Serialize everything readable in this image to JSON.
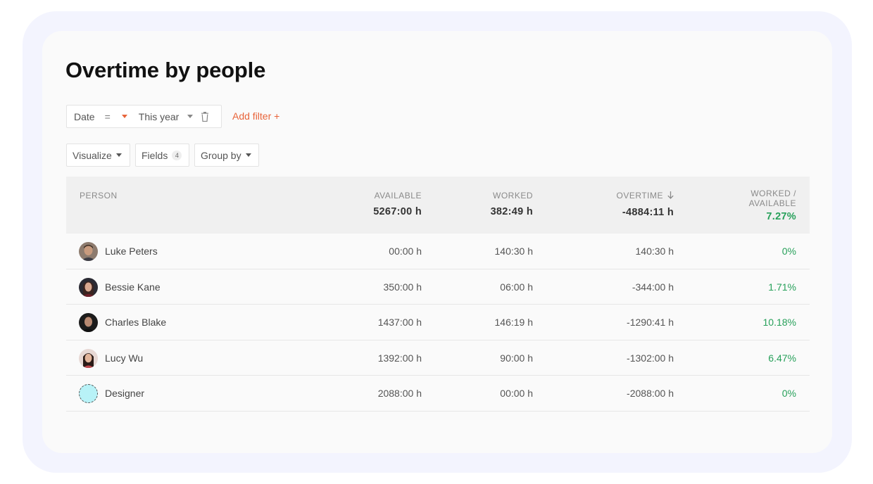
{
  "page": {
    "title": "Overtime by people"
  },
  "filter": {
    "field": "Date",
    "operator": "=",
    "value": "This year",
    "add_label": "Add filter +"
  },
  "toolbar": {
    "visualize_label": "Visualize",
    "fields_label": "Fields",
    "fields_count": "4",
    "group_by_label": "Group by"
  },
  "table": {
    "headers": {
      "person": "PERSON",
      "available": "AVAILABLE",
      "worked": "WORKED",
      "overtime": "OVERTIME",
      "ratio_line1": "WORKED /",
      "ratio_line2": "AVAILABLE"
    },
    "totals": {
      "available": "5267:00 h",
      "worked": "382:49 h",
      "overtime": "-4884:11 h",
      "ratio": "7.27%"
    },
    "rows": [
      {
        "name": "Luke Peters",
        "available": "00:00 h",
        "worked": "140:30 h",
        "overtime": "140:30 h",
        "ratio": "0%"
      },
      {
        "name": "Bessie Kane",
        "available": "350:00 h",
        "worked": "06:00 h",
        "overtime": "-344:00 h",
        "ratio": "1.71%"
      },
      {
        "name": "Charles Blake",
        "available": "1437:00 h",
        "worked": "146:19 h",
        "overtime": "-1290:41 h",
        "ratio": "10.18%"
      },
      {
        "name": "Lucy Wu",
        "available": "1392:00 h",
        "worked": "90:00 h",
        "overtime": "-1302:00 h",
        "ratio": "6.47%"
      },
      {
        "name": "Designer",
        "available": "2088:00 h",
        "worked": "00:00 h",
        "overtime": "-2088:00 h",
        "ratio": "0%"
      }
    ]
  },
  "colors": {
    "accent": "#e8643a",
    "positive": "#27a05a"
  },
  "icons": {
    "filter_operator_caret": "caret-down-icon",
    "delete_filter": "trash-icon",
    "sort": "arrow-down-icon"
  }
}
